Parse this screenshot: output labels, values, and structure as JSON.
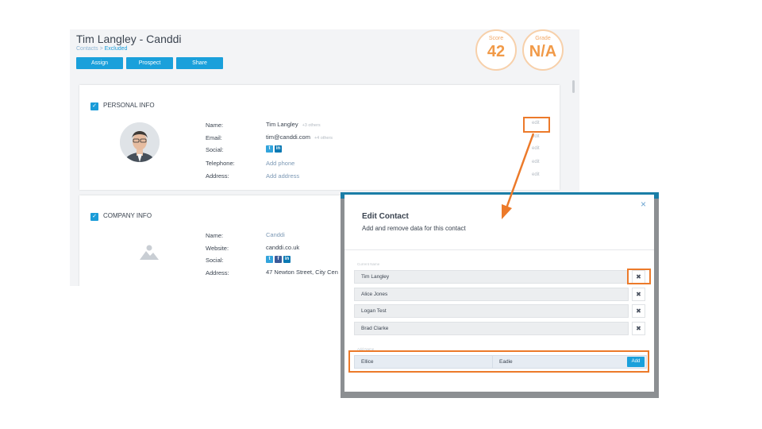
{
  "header": {
    "title": "Tim Langley - Canddi",
    "breadcrumb_root": "Contacts",
    "breadcrumb_sep": " > ",
    "breadcrumb_current": "Excluded"
  },
  "actions": {
    "assign": "Assign",
    "prospect": "Prospect",
    "share": "Share"
  },
  "score": {
    "label": "Score",
    "value": "42"
  },
  "grade": {
    "label": "Grade",
    "value": "N/A"
  },
  "personal": {
    "heading": "PERSONAL INFO",
    "name_label": "Name:",
    "name_value": "Tim Langley",
    "name_others": "+3 others",
    "email_label": "Email:",
    "email_value": "tim@canddi.com",
    "email_others": "+4 others",
    "social_label": "Social:",
    "telephone_label": "Telephone:",
    "telephone_value": "Add phone",
    "address_label": "Address:",
    "address_value": "Add address",
    "edit": "edit"
  },
  "company": {
    "heading": "COMPANY INFO",
    "name_label": "Name:",
    "name_value": "Canddi",
    "website_label": "Website:",
    "website_value": "canddi.co.uk",
    "social_label": "Social:",
    "address_label": "Address:",
    "address_value": "47 Newton Street, City Cen"
  },
  "social_icons": {
    "twitter": "t",
    "facebook": "f",
    "linkedin": "in"
  },
  "modal": {
    "close": "×",
    "title": "Edit Contact",
    "subtitle": "Add and remove data for this contact",
    "current_label": "Current Name",
    "add_label": "Add Name",
    "names": [
      {
        "value": "Tim Langley",
        "delete": "✖"
      },
      {
        "value": "Alice Jones",
        "delete": "✖"
      },
      {
        "value": "Logan Test",
        "delete": "✖"
      },
      {
        "value": "Brad Clarke",
        "delete": "✖"
      }
    ],
    "new_first": "Ellice",
    "new_last": "Eadie",
    "add_button": "Add"
  },
  "colors": {
    "accent": "#1aa0db",
    "highlight": "#ec7a2a",
    "score": "#f19a48"
  }
}
